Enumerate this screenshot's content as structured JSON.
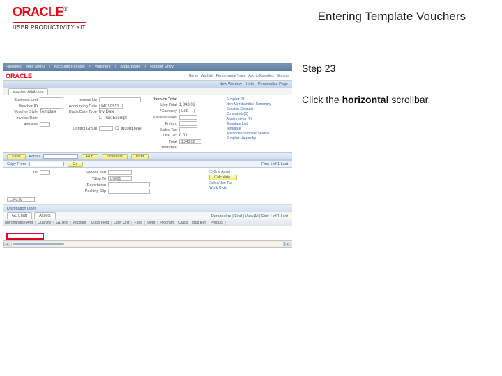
{
  "header": {
    "brand": "ORACLE",
    "reg": "®",
    "product_line": "USER PRODUCTIVITY KIT",
    "page_title": "Entering Template Vouchers"
  },
  "instructions": {
    "step_label": "Step 23",
    "line_prefix": "Click the ",
    "line_bold": "horizontal",
    "line_suffix": " scrollbar."
  },
  "app": {
    "breadcrumb": [
      "Favorites",
      "Main Menu",
      "Accounts Payable",
      "Vouchers",
      "Add/Update",
      "Regular Entry"
    ],
    "brand_inner": "ORACLE",
    "top_links": [
      "Home",
      "Worklist",
      "Performance Trace",
      "Add to Favorites",
      "Sign out"
    ],
    "subhead_left": "",
    "subhead_right": [
      "New Window",
      "Help",
      "Personalize Page"
    ],
    "tabs": {
      "a": "Voucher Attributes"
    },
    "left_fields": {
      "invoice_no_label": "Invoice No",
      "accounting_date_label": "Accounting Date",
      "accounting_date_value": "04/15/2013",
      "basis_dt_label": "Basis Date Type",
      "basis_dt_value": "Inv Date",
      "tax_exempt_label": "Tax Exempt",
      "control_group_label": "Control Group",
      "incomplete_label": "Incomplete"
    },
    "left_side": {
      "business_unit_label": "Business Unit",
      "voucher_id_label": "Voucher ID",
      "voucher_style_label": "Voucher Style",
      "voucher_style_value": "Template",
      "invoice_date_label": "Invoice Date",
      "address_label": "Address",
      "address_value": "1"
    },
    "mid_fields": {
      "invoice_total_label": "Invoice Total",
      "line_total_label": "Line Total",
      "line_total_value": "1,343.02",
      "currency_label": "*Currency",
      "currency_value": "USD",
      "misc_label": "Miscellaneous",
      "freight_label": "Freight",
      "sales_tax_label": "Sales Tax",
      "use_tax_label": "Use Tax",
      "use_tax_value": "0.00",
      "total_label": "Total",
      "total_value": "1,343.02",
      "difference_label": "Difference"
    },
    "right_links": {
      "a": "Supplier ID",
      "b": "Non Merchandise Summary",
      "c": "Session Defaults",
      "d": "Comments(0)",
      "e": "Attachments (0)",
      "f": "Template List",
      "g": "Template",
      "h": "Advanced Supplier Search",
      "i": "Supplier Hierarchy"
    },
    "save_btn": "Save",
    "action_label": "Action",
    "run_btn": "Run",
    "schedule_btn": "Schedule",
    "print_btn": "Print",
    "copy_from_label": "Copy From",
    "go_btn": "Go",
    "line_section": {
      "line_label": "Line",
      "speedchart_label": "SpeedChart",
      "ship_to_label": "*Ship To",
      "ship_to_value": "US001",
      "description_label": "Description",
      "packing_slip_label": "Packing Slip",
      "nav": "First 1 of 1 Last",
      "one_asset_label": "One Asset",
      "calc_label": "Calculate",
      "sut_label": "Sales/Use Tax",
      "wo_label": "Work Order"
    },
    "amount_field": "1,343.02",
    "dist_label": "Distribution Lines",
    "dist_tabs": {
      "a": "GL Chart",
      "b": "Assets"
    },
    "dist_nav": "Personalize | Find | View All | First 1 of 1 Last",
    "dist_cols": {
      "c0": "Merchandise Amt",
      "c1": "Quantity",
      "c2": "GL Unit",
      "c3": "Account",
      "c4": "Class Field",
      "c5": "Oper Unit",
      "c6": "Fund",
      "c7": "Dept",
      "c8": "Program",
      "c9": "Class",
      "c10": "Bud Ref",
      "c11": "Product"
    }
  }
}
